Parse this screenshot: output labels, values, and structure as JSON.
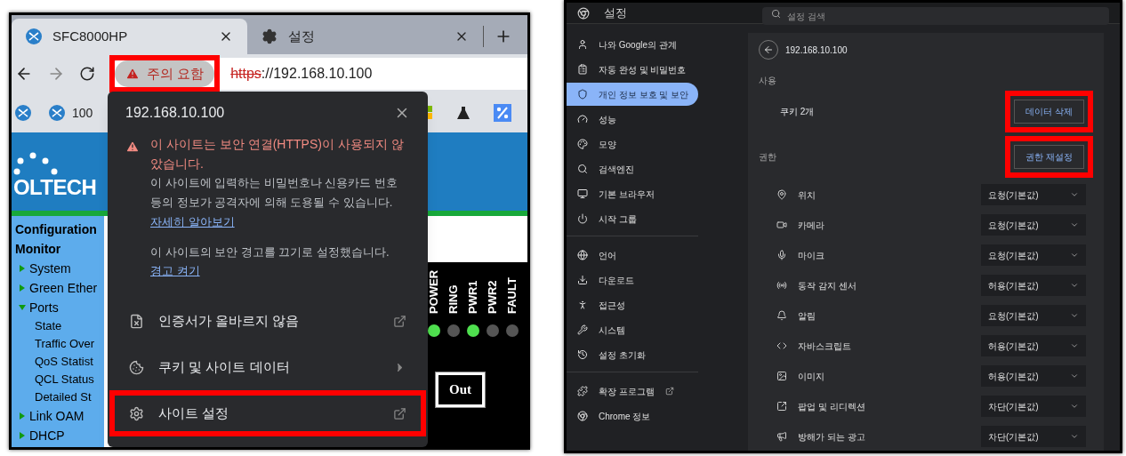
{
  "left_browser": {
    "tabs": [
      {
        "title": "SFC8000HP",
        "kind": "site",
        "selected": true
      },
      {
        "title": "설정",
        "kind": "settings",
        "selected": false
      }
    ],
    "security_chip": {
      "label": "주의 요함",
      "highlighted": true
    },
    "url": {
      "scheme": "https",
      "rest": "://192.168.10.100"
    },
    "bookmark_label": "100",
    "page": {
      "logo_text": "OLTECH",
      "menu": [
        {
          "label": "Configuration",
          "kind": "heading"
        },
        {
          "label": "Monitor",
          "kind": "heading"
        },
        {
          "label": "System",
          "kind": "folder",
          "expanded": false
        },
        {
          "label": "Green Ether",
          "kind": "folder",
          "expanded": false
        },
        {
          "label": "Ports",
          "kind": "folder",
          "expanded": true
        },
        {
          "label": "State",
          "kind": "leaf"
        },
        {
          "label": "Traffic Over",
          "kind": "leaf"
        },
        {
          "label": "QoS Statist",
          "kind": "leaf"
        },
        {
          "label": "QCL Status",
          "kind": "leaf"
        },
        {
          "label": "Detailed St",
          "kind": "leaf"
        },
        {
          "label": "Link OAM",
          "kind": "folder",
          "expanded": false
        },
        {
          "label": "DHCP",
          "kind": "folder",
          "expanded": false
        }
      ],
      "leds": [
        {
          "label": "POWER",
          "on": true
        },
        {
          "label": "RING",
          "on": false
        },
        {
          "label": "PWR1",
          "on": true
        },
        {
          "label": "PWR2",
          "on": false
        },
        {
          "label": "FAULT",
          "on": false
        }
      ],
      "button": "Out"
    },
    "popup": {
      "title": "192.168.10.100",
      "warning": "이 사이트는 보안 연결(HTTPS)이 사용되지 않았습니다.",
      "body": "이 사이트에 입력하는 비밀번호나 신용카드 번호 등의 정보가 공격자에 의해 도용될 수 있습니다.",
      "learn_more": "자세히 알아보기",
      "notice": "이 사이트의 보안 경고를 끄기로 설정했습니다.",
      "enable_link": "경고 켜기",
      "items": [
        {
          "kind": "certificate",
          "label": "인증서가 올바르지 않음",
          "external": true,
          "submenu": false,
          "highlighted": false
        },
        {
          "kind": "cookies",
          "label": "쿠키 및 사이트 데이터",
          "external": false,
          "submenu": true,
          "highlighted": false
        },
        {
          "kind": "settings",
          "label": "사이트 설정",
          "external": true,
          "submenu": false,
          "highlighted": true
        }
      ]
    }
  },
  "right_settings": {
    "title": "설정",
    "search": {
      "placeholder": "설정 검색"
    },
    "sidebar": [
      [
        {
          "label": "나와 Google의 관계",
          "kind": "person",
          "selected": false
        },
        {
          "label": "자동 완성 및 비밀번호",
          "kind": "clipboard",
          "selected": false
        },
        {
          "label": "개인 정보 보호 및 보안",
          "kind": "shield",
          "selected": true
        },
        {
          "label": "성능",
          "kind": "gauge",
          "selected": false
        },
        {
          "label": "모양",
          "kind": "palette",
          "selected": false
        },
        {
          "label": "검색엔진",
          "kind": "search",
          "selected": false
        },
        {
          "label": "기본 브라우저",
          "kind": "browser",
          "selected": false
        },
        {
          "label": "시작 그룹",
          "kind": "power",
          "selected": false
        }
      ],
      [
        {
          "label": "언어",
          "kind": "globe",
          "selected": false
        },
        {
          "label": "다운로드",
          "kind": "download",
          "selected": false
        },
        {
          "label": "접근성",
          "kind": "accessibility",
          "selected": false
        },
        {
          "label": "시스템",
          "kind": "wrench",
          "selected": false
        },
        {
          "label": "설정 초기화",
          "kind": "history",
          "selected": false
        }
      ],
      [
        {
          "label": "확장 프로그램",
          "kind": "puzzle",
          "external": true,
          "selected": false
        },
        {
          "label": "Chrome 정보",
          "kind": "chrome",
          "external": false,
          "selected": false
        }
      ]
    ],
    "site": "192.168.10.100",
    "usage_heading": "사용",
    "cookies": "쿠키 2개",
    "clear_button": {
      "label": "데이터 삭제",
      "highlighted": true
    },
    "permissions_heading": "권한",
    "reset_button": {
      "label": "권한 재설정",
      "highlighted": true
    },
    "permissions": [
      {
        "label": "위치",
        "kind": "pin",
        "value": "요청(기본값)"
      },
      {
        "label": "카메라",
        "kind": "camera",
        "value": "요청(기본값)"
      },
      {
        "label": "마이크",
        "kind": "mic",
        "value": "요청(기본값)"
      },
      {
        "label": "동작 감지 센서",
        "kind": "sensor",
        "value": "허용(기본값)"
      },
      {
        "label": "알림",
        "kind": "bell",
        "value": "요청(기본값)"
      },
      {
        "label": "자바스크립트",
        "kind": "code",
        "value": "허용(기본값)"
      },
      {
        "label": "이미지",
        "kind": "image",
        "value": "허용(기본값)"
      },
      {
        "label": "팝업 및 리디렉션",
        "kind": "popup",
        "value": "차단(기본값)"
      },
      {
        "label": "방해가 되는 광고",
        "kind": "ads",
        "value": "차단(기본값)"
      }
    ]
  }
}
